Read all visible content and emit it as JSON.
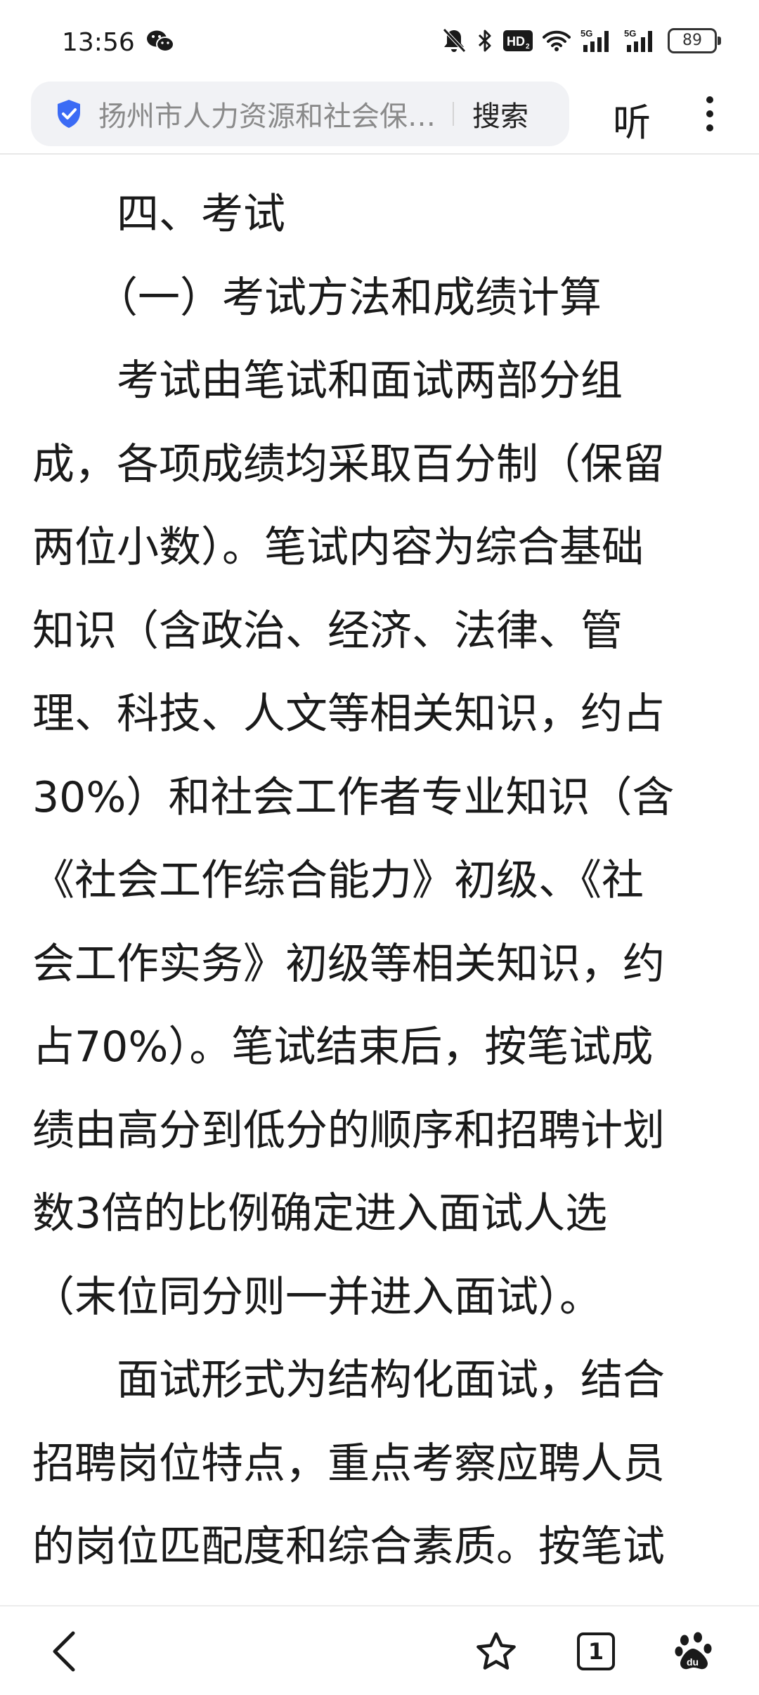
{
  "status_bar": {
    "time": "13:56",
    "battery": "89",
    "icons": [
      "wechat-icon",
      "mute-icon",
      "bluetooth-icon",
      "hd-icon",
      "wifi-icon",
      "signal-5g-icon",
      "signal-5g-icon",
      "battery-icon"
    ],
    "hd_label": "HD",
    "net_label": "5G"
  },
  "toolbar": {
    "url_title": "扬州市人力资源和社会保…",
    "search_label": "搜索",
    "listen_label": "听",
    "accent_color": "#3b6bf5"
  },
  "article": {
    "lines": [
      "　　四、考试",
      "　　（一）考试方法和成绩计算",
      "　　考试由笔试和面试两部分组",
      "成，各项成绩均采取百分制（保留",
      "两位小数）。笔试内容为综合基础",
      "知识（含政治、经济、法律、管",
      "理、科技、人文等相关知识，约占",
      "30%）和社会工作者专业知识（含",
      "《社会工作综合能力》初级、《社",
      "会工作实务》初级等相关知识，约",
      "占70%）。笔试结束后，按笔试成",
      "绩由高分到低分的顺序和招聘计划",
      "数3倍的比例确定进入面试人选",
      "（末位同分则一并进入面试）。",
      "　　面试形式为结构化面试，结合",
      "招聘岗位特点，重点考察应聘人员",
      "的岗位匹配度和综合素质。按笔试"
    ]
  },
  "bottom_nav": {
    "tab_count": "1",
    "icons": [
      "back-icon",
      "star-icon",
      "tabs-icon",
      "baidu-paw-icon"
    ]
  }
}
